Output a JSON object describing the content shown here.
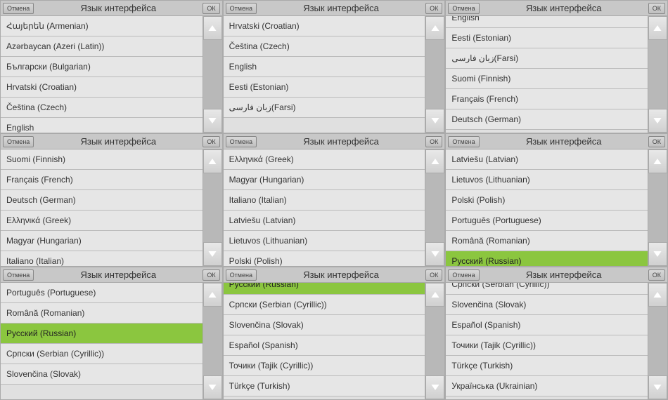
{
  "header": {
    "cancel_label": "Отмена",
    "title": "Язык интерфейса",
    "ok_label": "ОК"
  },
  "panels": [
    {
      "items": [
        {
          "label": "Հայերեն (Armenian)"
        },
        {
          "label": "Azərbaycan (Azeri (Latin))"
        },
        {
          "label": "Български (Bulgarian)"
        },
        {
          "label": "Hrvatski (Croatian)"
        },
        {
          "label": "Čeština (Czech)"
        },
        {
          "label": "English",
          "partial": "bottom"
        }
      ]
    },
    {
      "items": [
        {
          "label": "Hrvatski (Croatian)"
        },
        {
          "label": "Čeština (Czech)"
        },
        {
          "label": "English"
        },
        {
          "label": "Eesti (Estonian)"
        },
        {
          "label": "زبان فارسی(Farsi)"
        }
      ]
    },
    {
      "items": [
        {
          "label": "English",
          "partial": "top"
        },
        {
          "label": "Eesti (Estonian)"
        },
        {
          "label": "زبان فارسی(Farsi)"
        },
        {
          "label": "Suomi (Finnish)"
        },
        {
          "label": "Français (French)"
        },
        {
          "label": "Deutsch (German)"
        }
      ]
    },
    {
      "items": [
        {
          "label": "Suomi (Finnish)"
        },
        {
          "label": "Français (French)"
        },
        {
          "label": "Deutsch (German)"
        },
        {
          "label": "Ελληνικά  (Greek)"
        },
        {
          "label": "Magyar (Hungarian)"
        },
        {
          "label": "Italiano (Italian)"
        }
      ]
    },
    {
      "items": [
        {
          "label": "Ελληνικά  (Greek)"
        },
        {
          "label": "Magyar (Hungarian)"
        },
        {
          "label": "Italiano (Italian)"
        },
        {
          "label": "Latviešu (Latvian)"
        },
        {
          "label": "Lietuvos (Lithuanian)"
        },
        {
          "label": "Polski (Polish)"
        }
      ]
    },
    {
      "items": [
        {
          "label": "Latviešu (Latvian)"
        },
        {
          "label": "Lietuvos (Lithuanian)"
        },
        {
          "label": "Polski (Polish)"
        },
        {
          "label": "Português (Portuguese)"
        },
        {
          "label": "Română (Romanian)"
        },
        {
          "label": "Русский (Russian)",
          "selected": true,
          "partial": "bottom"
        }
      ]
    },
    {
      "items": [
        {
          "label": "Português (Portuguese)"
        },
        {
          "label": "Română (Romanian)"
        },
        {
          "label": "Русский (Russian)",
          "selected": true
        },
        {
          "label": "Српски (Serbian (Cyrillic))"
        },
        {
          "label": "Slovenčina (Slovak)"
        }
      ]
    },
    {
      "items": [
        {
          "label": "Русский (Russian)",
          "selected": true,
          "partial": "top"
        },
        {
          "label": "Српски (Serbian (Cyrillic))"
        },
        {
          "label": "Slovenčina (Slovak)"
        },
        {
          "label": "Español (Spanish)"
        },
        {
          "label": "Точики (Tajik (Cyrillic))"
        },
        {
          "label": "Türkçe (Turkish)"
        }
      ]
    },
    {
      "items": [
        {
          "label": "Српски (Serbian (Cyrillic))",
          "partial": "top"
        },
        {
          "label": "Slovenčina (Slovak)"
        },
        {
          "label": "Español (Spanish)"
        },
        {
          "label": "Точики (Tajik (Cyrillic))"
        },
        {
          "label": "Türkçe (Turkish)"
        },
        {
          "label": "Українська (Ukrainian)"
        }
      ]
    }
  ]
}
